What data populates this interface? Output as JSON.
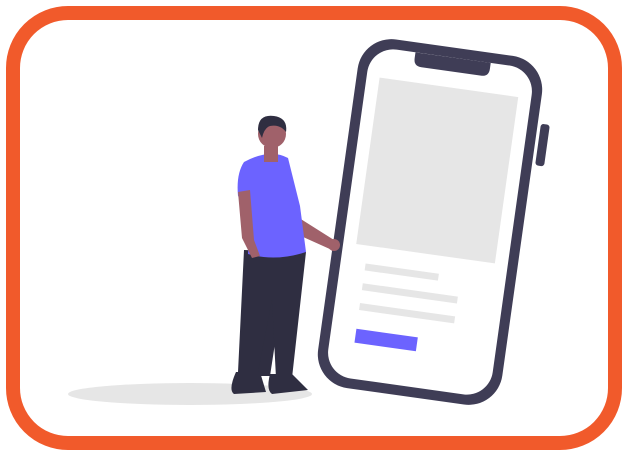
{
  "frame": {
    "border_color": "#f15a2b",
    "background": "#ffffff"
  },
  "illustration": {
    "name": "person-with-smartphone",
    "colors": {
      "phone_body": "#3f3d56",
      "screen": "#ffffff",
      "image_placeholder": "#e6e6e6",
      "text_line": "#e6e6e6",
      "accent_button": "#6c63ff",
      "shirt": "#6c63ff",
      "pants": "#2f2e41",
      "skin": "#a0616a",
      "hair": "#2f2e41",
      "shoes": "#2f2e41",
      "shadow": "#e6e6e6"
    }
  }
}
